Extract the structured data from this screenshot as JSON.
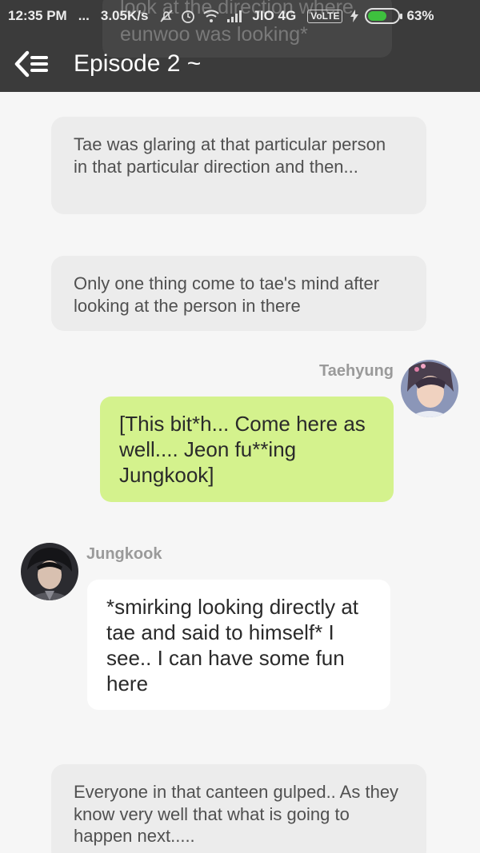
{
  "status_bar": {
    "time": "12:35 PM",
    "dots": "...",
    "speed": "3.05K/s",
    "carrier": "JIO 4G",
    "volte": "VoLTE",
    "battery_percent": "63%",
    "battery_level": 0.63
  },
  "ghost_text": {
    "line1": "look at the direction where",
    "line2": "eunwoo was looking*"
  },
  "header": {
    "title": "Episode 2 ~"
  },
  "messages": {
    "narration1": "Tae was glaring at that particular person in that particular direction and then...",
    "narration2": "Only one thing come to tae's mind after looking at the person in there",
    "taehyung": {
      "name": "Taehyung",
      "text": "[This bit*h... Come here as well.... Jeon fu**ing Jungkook]"
    },
    "jungkook": {
      "name": "Jungkook",
      "text": "*smirking looking directly at tae and said to himself* I see.. I can have some fun here"
    },
    "narration3": "Everyone in that canteen gulped.. As they know very well that what is going to happen next....."
  },
  "colors": {
    "header_bg": "#3b3b3b",
    "green_bubble": "#d4f28d",
    "narration_card": "#ececec",
    "page_bg": "#f6f6f6"
  }
}
